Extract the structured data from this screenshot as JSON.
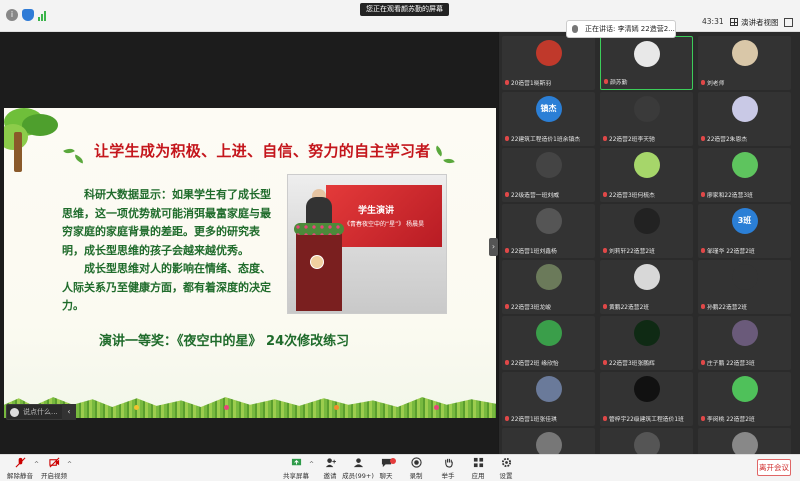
{
  "topbar": {
    "share_notice": "您正在观看颜苏勤的屏幕",
    "time": "43:31",
    "view_label": "演讲者视图",
    "speaking_label": "正在讲话: 李清嫣 22造营2..."
  },
  "slide": {
    "title": "让学生成为积极、上进、自信、努力的自主学习者",
    "paragraph1": "科研大数据显示：如果学生有了成长型思维，这一项优势就可能消弭最富家庭与最穷家庭的家庭背景的差距。更多的研究表明，成长型思维的孩子会越来越优秀。",
    "paragraph2": "成长型思维对人的影响在情绪、态度、人际关系乃至健康方面，都有着深度的决定力。",
    "footer": "演讲一等奖：《夜空中的星》 24次修改练习",
    "photo_board_title": "学生演讲",
    "photo_board_sub": "《青春夜空中的“星”》 杨晨昊"
  },
  "chat": {
    "placeholder": "说点什么..."
  },
  "gallery": {
    "participants": [
      {
        "name": "20造营1晓斯羽",
        "avatar": "",
        "color": "#c0392b"
      },
      {
        "name": "颜苏勤",
        "avatar": "",
        "color": "#e8e8e8"
      },
      {
        "name": "刘老师",
        "avatar": "",
        "color": "#d9c7a8"
      },
      {
        "name": "22建筑工程造价1班余镇杰",
        "avatar": "镇杰",
        "color": "#2b7fd6"
      },
      {
        "name": "22造营2班李天驰",
        "avatar": "",
        "color": "#3a3a3a"
      },
      {
        "name": "22造营2朱恩杰",
        "avatar": "",
        "color": "#c9c9e6"
      },
      {
        "name": "22级造营一班刘威",
        "avatar": "",
        "color": "#444"
      },
      {
        "name": "22造营3班何梳杰",
        "avatar": "",
        "color": "#a6d66a"
      },
      {
        "name": "廖家和22造营3班",
        "avatar": "",
        "color": "#5ec45e"
      },
      {
        "name": "22造营1班刘鑫杨",
        "avatar": "",
        "color": "#555"
      },
      {
        "name": "刘莉轩22造营2班",
        "avatar": "",
        "color": "#222"
      },
      {
        "name": "邹瑾华 22造营2班",
        "avatar": "3班",
        "color": "#2b7fd6"
      },
      {
        "name": "22造营3班龙峻",
        "avatar": "",
        "color": "#6b7a5a"
      },
      {
        "name": "黄鹏22造营2班",
        "avatar": "",
        "color": "#d8d8d8"
      },
      {
        "name": "孙鹏22造营2班",
        "avatar": "",
        "color": "#333"
      },
      {
        "name": "22造营2班 缘欣怡",
        "avatar": "",
        "color": "#3a9e4a"
      },
      {
        "name": "22造营3班张鹏辉",
        "avatar": "",
        "color": "#0f2a14"
      },
      {
        "name": "庄子鹏 22造营3班",
        "avatar": "",
        "color": "#6a5a7a"
      },
      {
        "name": "22造营1班张佳琪",
        "avatar": "",
        "color": "#6a7a9a"
      },
      {
        "name": "管梓宇22级建筑工程造价1班",
        "avatar": "",
        "color": "#111"
      },
      {
        "name": "李闵桃 22造营2班",
        "avatar": "",
        "color": "#4fc15a"
      },
      {
        "name": "",
        "avatar": "",
        "color": "#777"
      },
      {
        "name": "",
        "avatar": "",
        "color": "#555"
      },
      {
        "name": "",
        "avatar": "",
        "color": "#888"
      }
    ]
  },
  "toolbar": {
    "mute": "解除静音",
    "video": "开启视频",
    "share": "共享屏幕",
    "invite": "邀请",
    "members": "成员(99+)",
    "chat": "聊天",
    "record": "录制",
    "raise_hand": "举手",
    "apps": "应用",
    "settings": "设置",
    "leave": "离开会议"
  },
  "colors": {
    "accent_green": "#3ccd5a",
    "leave_red": "#d02c2c",
    "title_red": "#c4161c",
    "body_green": "#1f6b2b"
  }
}
